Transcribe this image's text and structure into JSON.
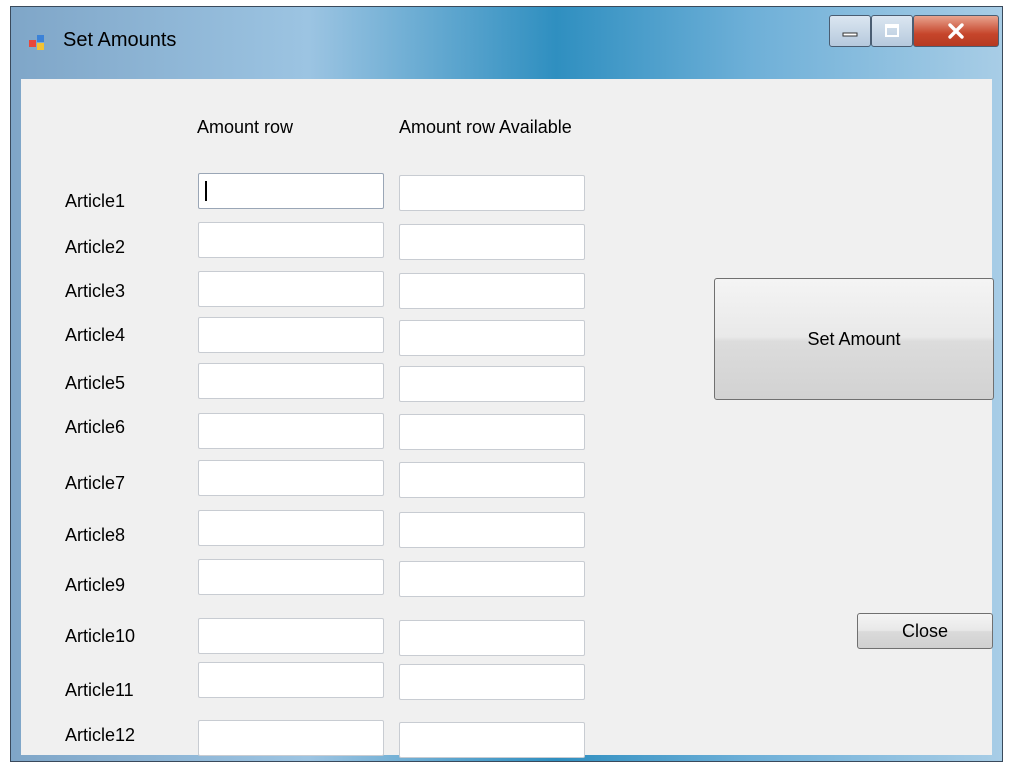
{
  "window": {
    "title": "Set Amounts"
  },
  "columns": {
    "amount_row": "Amount row",
    "amount_row_available": "Amount row Available"
  },
  "articles": [
    {
      "label": "Article1",
      "amount": "",
      "available": ""
    },
    {
      "label": "Article2",
      "amount": "",
      "available": ""
    },
    {
      "label": "Article3",
      "amount": "",
      "available": ""
    },
    {
      "label": "Article4",
      "amount": "",
      "available": ""
    },
    {
      "label": "Article5",
      "amount": "",
      "available": ""
    },
    {
      "label": "Article6",
      "amount": "",
      "available": ""
    },
    {
      "label": "Article7",
      "amount": "",
      "available": ""
    },
    {
      "label": "Article8",
      "amount": "",
      "available": ""
    },
    {
      "label": "Article9",
      "amount": "",
      "available": ""
    },
    {
      "label": "Article10",
      "amount": "",
      "available": ""
    },
    {
      "label": "Article11",
      "amount": "",
      "available": ""
    },
    {
      "label": "Article12",
      "amount": "",
      "available": ""
    }
  ],
  "buttons": {
    "set_amount": "Set Amount",
    "close": "Close"
  },
  "icons": {
    "app": "app-icon",
    "minimize": "minimize-icon",
    "maximize": "maximize-icon",
    "close": "close-x-icon"
  }
}
